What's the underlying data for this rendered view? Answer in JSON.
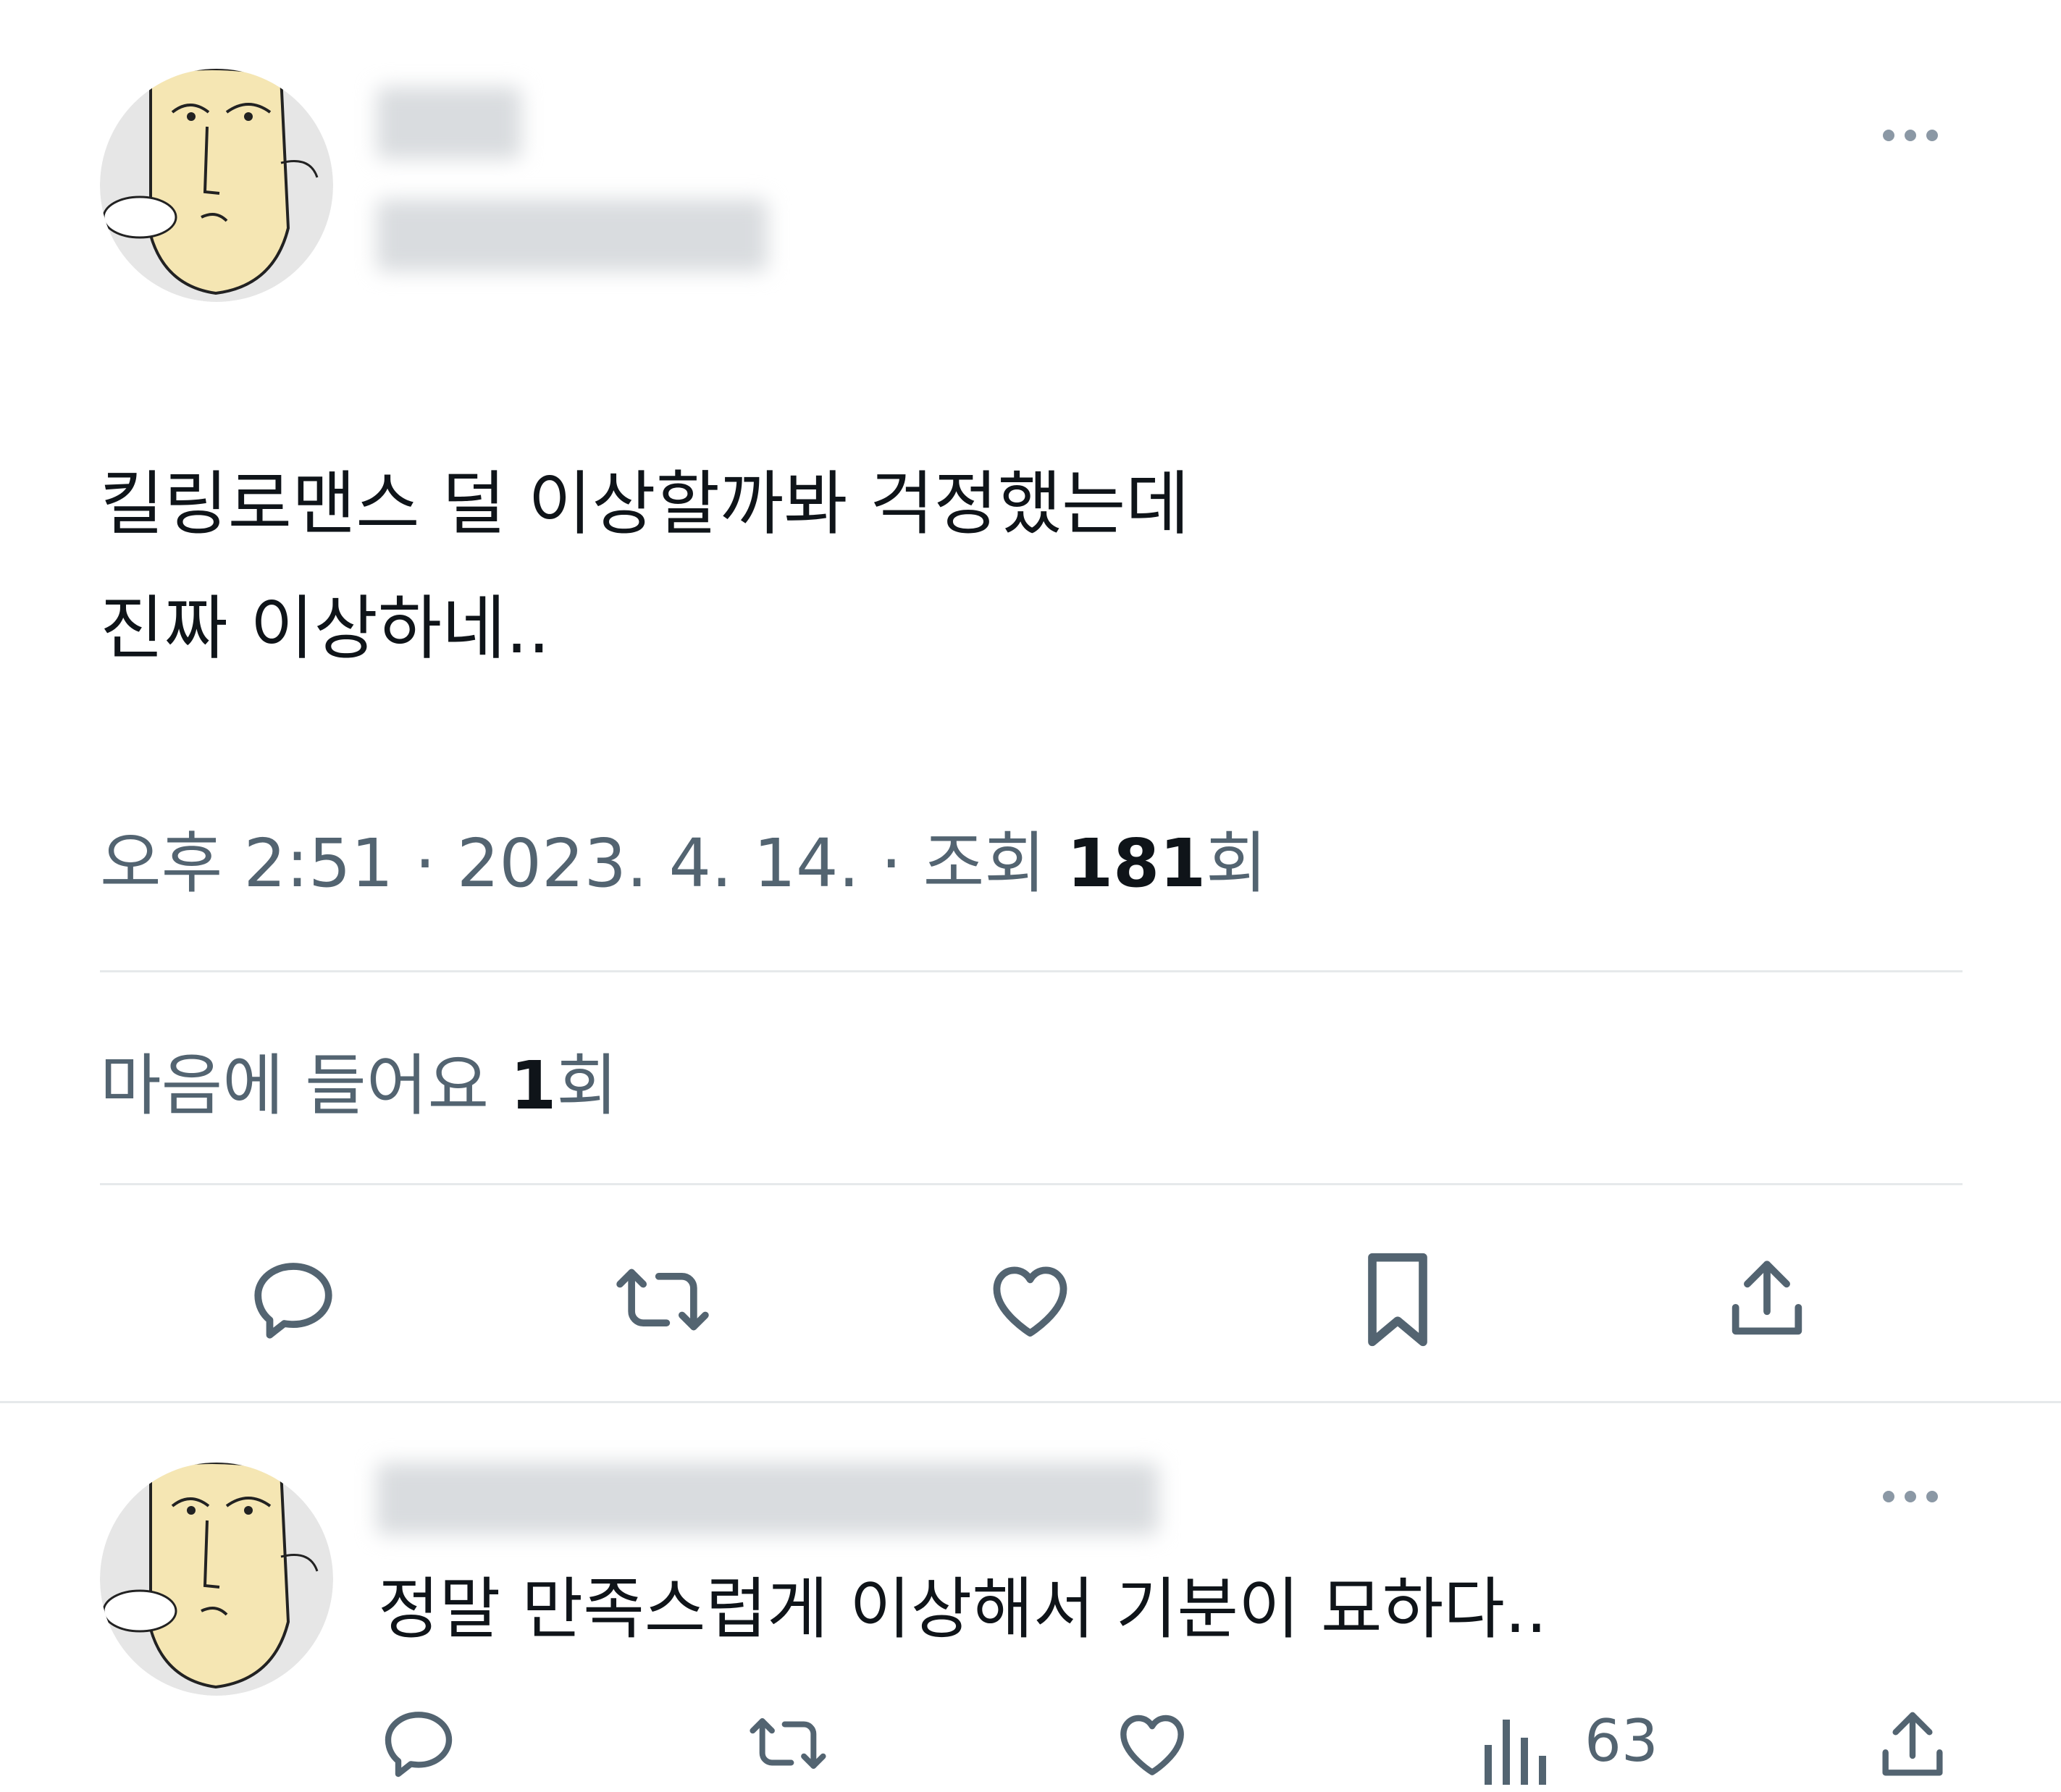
{
  "main_tweet": {
    "text_line1": "킬링로맨스 덜 이상할까봐 걱정했는데",
    "text_line2": "진짜 이상하네..",
    "time": "오후 2:51",
    "date": "2023. 4. 14.",
    "views_label": "조회",
    "views_count": "181",
    "views_suffix": "회",
    "likes_label": "마음에 들어요",
    "likes_count": "1",
    "likes_suffix": "회",
    "actions": [
      "reply-icon",
      "retweet-icon",
      "like-icon",
      "bookmark-icon",
      "share-icon"
    ]
  },
  "reply_tweet": {
    "text": "정말 만족스럽게 이상해서 기분이 묘하다..",
    "views_count": "63",
    "actions": [
      "reply-icon",
      "retweet-icon",
      "like-icon",
      "views-icon",
      "share-icon"
    ]
  },
  "colors": {
    "text": "#0f1419",
    "secondary": "#536471",
    "divider": "#e6e9eb",
    "icon": "#536471",
    "avatar_skin": "#f5e6b3"
  }
}
